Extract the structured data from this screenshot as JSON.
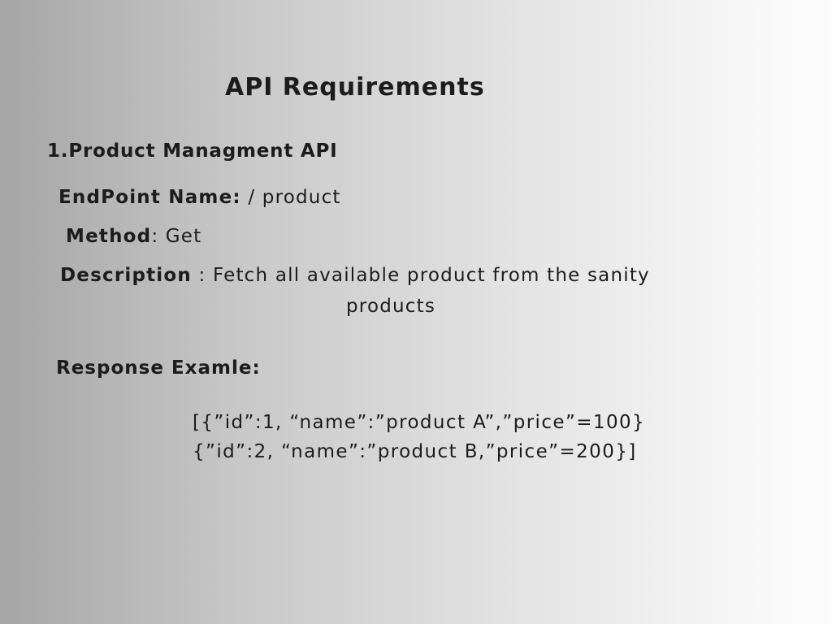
{
  "title": "API Requirements",
  "section": {
    "heading": "1.Product Managment API"
  },
  "endpoint": {
    "label": "EndPoint Name:",
    "value": " / product"
  },
  "method": {
    "label": "Method",
    "value": ": Get"
  },
  "description": {
    "label": "Description",
    "value_line1": " : Fetch all available product from the sanity",
    "value_line2": "products"
  },
  "response": {
    "label": "Response Examle:",
    "lines": [
      "[{”id”:1, “name”:”product A”,”price”=100}",
      "{”id”:2, “name”:”product B,”price”=200}]"
    ]
  }
}
